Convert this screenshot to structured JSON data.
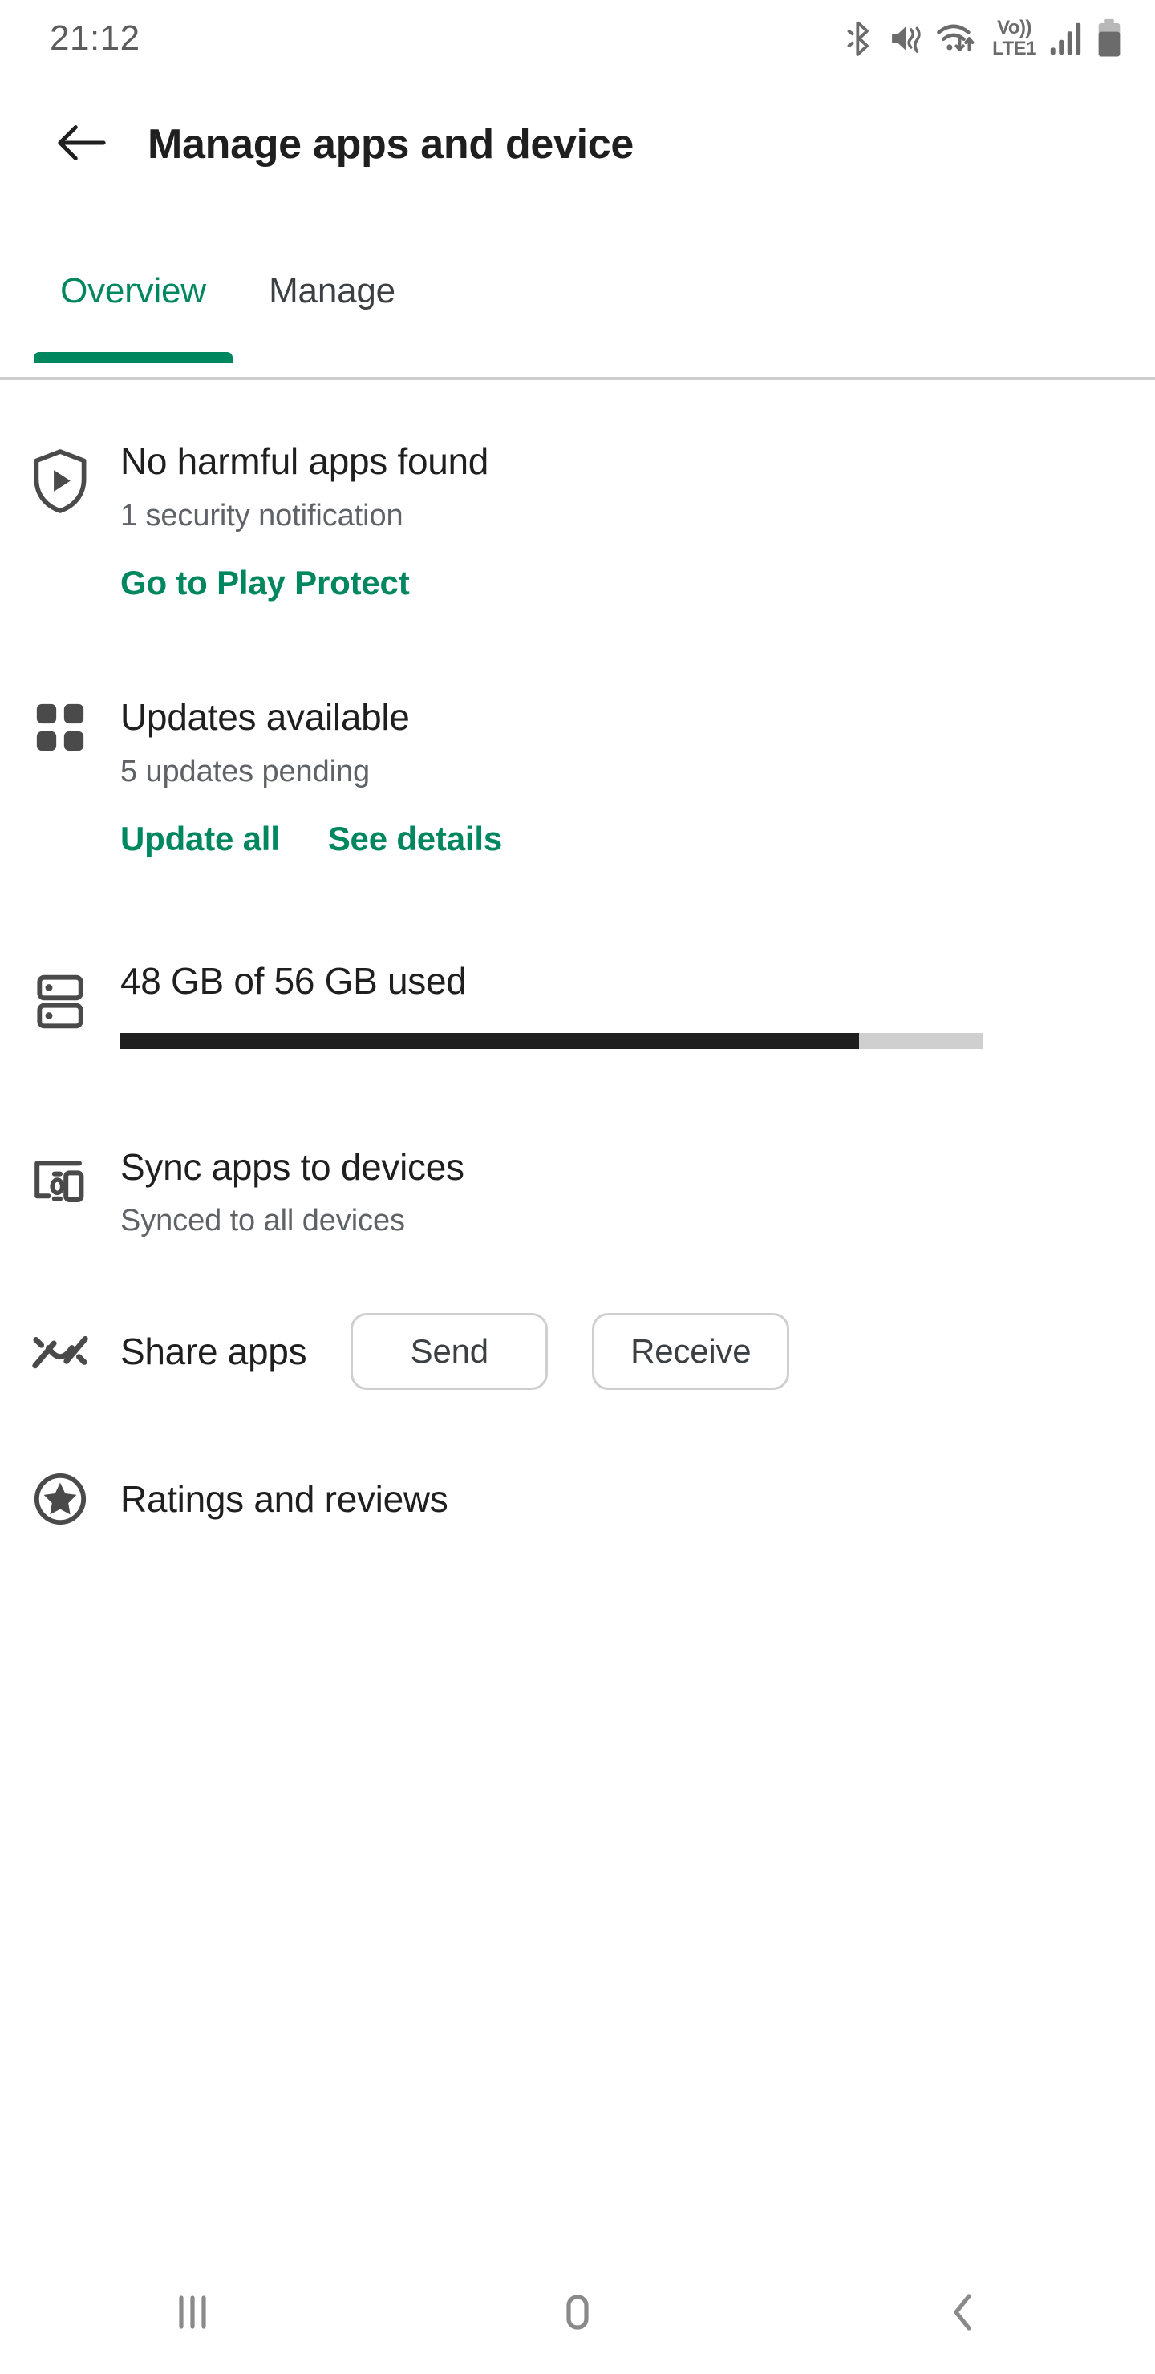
{
  "status_bar": {
    "clock": "21:12",
    "icons": [
      "bluetooth-icon",
      "vibrate-mute-icon",
      "wifi-data-icon",
      "volte-lte1-icon",
      "signal-bars-icon",
      "battery-icon"
    ],
    "volte_top": "Vo))",
    "volte_bottom": "LTE1"
  },
  "app_bar": {
    "back_label": "back-arrow",
    "title": "Manage apps and device"
  },
  "tabs": {
    "items": [
      {
        "label": "Overview",
        "active": true
      },
      {
        "label": "Manage",
        "active": false
      }
    ]
  },
  "sections": {
    "play_protect": {
      "icon": "shield-play-icon",
      "title": "No harmful apps found",
      "subtitle": "1 security notification",
      "action": "Go to Play Protect"
    },
    "updates": {
      "icon": "apps-grid-icon",
      "title": "Updates available",
      "subtitle": "5 updates pending",
      "action_primary": "Update all",
      "action_secondary": "See details"
    },
    "storage": {
      "icon": "storage-icon",
      "title": "48 GB of 56 GB used",
      "used_gb": 48,
      "total_gb": 56,
      "percent": 85.7,
      "fill_color": "#1f1f1f",
      "track_color": "#cfcfcf"
    },
    "sync": {
      "icon": "devices-icon",
      "title": "Sync apps to devices",
      "subtitle": "Synced to all devices"
    },
    "share": {
      "icon": "nearby-share-icon",
      "title": "Share apps",
      "send_label": "Send",
      "receive_label": "Receive"
    },
    "ratings": {
      "icon": "star-circle-icon",
      "title": "Ratings and reviews"
    }
  },
  "nav_bar": {
    "recents": "recents-icon",
    "home": "home-icon",
    "back": "back-icon"
  },
  "colors": {
    "accent_green": "#01875f",
    "text_primary": "#1f1f1f",
    "text_secondary": "#5f6368",
    "divider": "#cdcdcd"
  }
}
